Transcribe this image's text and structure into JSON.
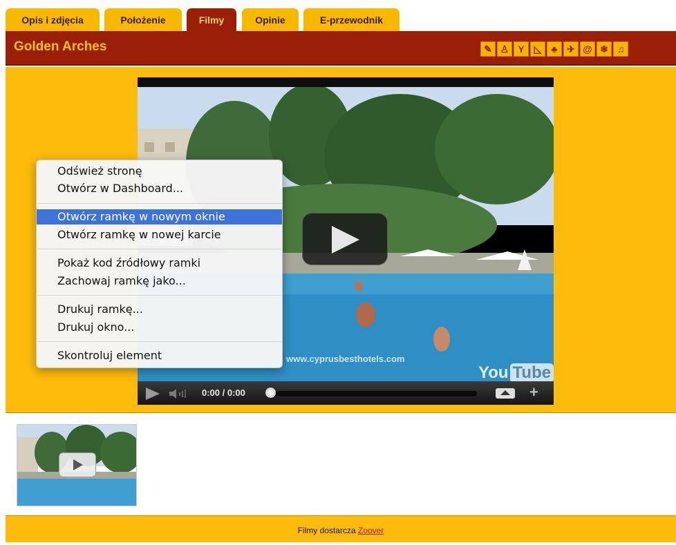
{
  "tabs": [
    {
      "label": "Opis i zdjęcia"
    },
    {
      "label": "Położenie"
    },
    {
      "label": "Filmy"
    },
    {
      "label": "Opinie"
    },
    {
      "label": "E-przewodnik"
    }
  ],
  "header": {
    "title": "Golden Arches",
    "icons": [
      "restaurant-icon",
      "family-icon",
      "bar-icon",
      "beach-icon",
      "kids-club-icon",
      "sports-icon",
      "internet-icon",
      "air-conditioning-icon",
      "music-icon"
    ]
  },
  "video": {
    "watermark": "www.cyprusbesthotels.com",
    "logo_you": "You",
    "logo_tube": "Tube",
    "time": "0:00 / 0:00"
  },
  "context_menu": {
    "items": [
      "Odśwież stronę",
      "Otwórz w Dashboard...",
      "Otwórz ramkę w nowym oknie",
      "Otwórz ramkę w nowej karcie",
      "Pokaż kod źródłowy ramki",
      "Zachowaj ramkę jako...",
      "Drukuj ramkę...",
      "Drukuj okno...",
      "Skontroluj element"
    ],
    "highlighted_index": 2
  },
  "footer": {
    "text": "Filmy dostarcza",
    "link": "Zoover"
  },
  "colors": {
    "tab": "#f7b900",
    "tab_active": "#9a1f06",
    "header_bg": "#9a1f06",
    "title": "#ffc21a",
    "panel": "#fdbb0b",
    "menu_highlight": "#3d73d8"
  }
}
